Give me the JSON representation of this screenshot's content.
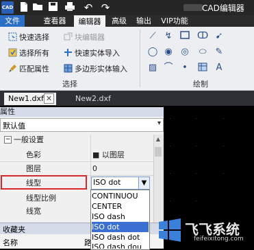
{
  "title_bar": {
    "logo_text": "CAD",
    "app_title": "CAD编辑器",
    "icons": [
      "new-file-icon",
      "open-folder-icon",
      "save-icon",
      "print-icon",
      "undo-icon",
      "redo-icon"
    ]
  },
  "menu": {
    "items": [
      "文件",
      "查看器",
      "编辑器",
      "高级",
      "输出",
      "VIP功能"
    ],
    "active": "编辑器"
  },
  "ribbon": {
    "select_group": {
      "label": "选择",
      "quick_select": "快速选择",
      "select_all": "选择所有",
      "match_props": "匹配属性",
      "block_editor": "块编辑器",
      "quick_entity_import": "快速实体导入",
      "polygon_entity_input": "多边形实体输入"
    },
    "draw_group": {
      "label": "绘制"
    }
  },
  "doc_tabs": [
    {
      "label": "New1.dxf",
      "active": true
    },
    {
      "label": "New2.dxf",
      "active": false
    }
  ],
  "properties": {
    "header": "属性",
    "combo_value": "默认值",
    "section": "一般设置",
    "rows": [
      {
        "label": "色彩",
        "value": "■ 以图层"
      },
      {
        "label": "图层",
        "value": "0"
      },
      {
        "label": "线型",
        "value": "ISO dot"
      },
      {
        "label": "线型比例",
        "value": ""
      },
      {
        "label": "线宽",
        "value": ""
      }
    ],
    "favorites_header": "收藏夹",
    "name_col": "名称",
    "path_col": "路"
  },
  "linetype_dropdown": {
    "options": [
      "CONTINUOU",
      "CENTER",
      "ISO dash",
      "ISO dot",
      "ISO dash dot",
      "ISO dash dou"
    ],
    "selected": "ISO dot"
  },
  "watermark": {
    "text": "飞飞系统",
    "url": "feifeixitong.com"
  },
  "colors": {
    "accent": "#2c6fc7",
    "highlight_red": "#d9262a",
    "selection_blue": "#3b6fd1"
  }
}
